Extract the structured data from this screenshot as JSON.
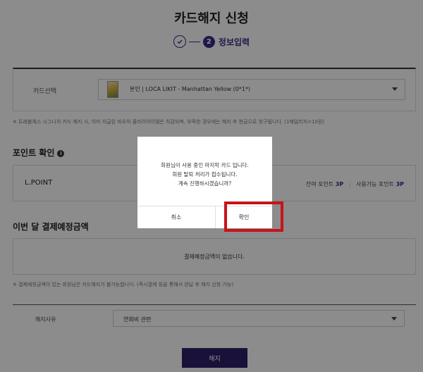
{
  "page": {
    "title": "카드해지 신청",
    "steps": {
      "current_number": "2",
      "current_label": "정보입력"
    }
  },
  "card_section": {
    "label": "카드선택",
    "selected_card": "본인 | LOCA LIKIT - Manhattan Yellow (0*1*)"
  },
  "note_top": "※ 트래블체스 시그니처 카드 해지 시, 이미 지급된 바우처 플라이아이템은 차감되며, 부족한 경우에는 해지 후 현금으로 청구됩니다. (1매일리지=10원)",
  "points": {
    "title": "포인트 확인",
    "info_icon": "i",
    "name": "L.POINT",
    "remaining_label": "잔여 포인트",
    "remaining_value": "3P",
    "usable_label": "사용가능 포인트",
    "usable_value": "3P"
  },
  "payment": {
    "title": "이번 달 결제예정금액",
    "message": "결제예정금액이 없습니다."
  },
  "note_bottom": "※ 결제예정금액이 있는 회원님은 카드해지가 불가능합니다. (즉시결제 등을 통해서 완납 후 해지 신청 가능)",
  "reason": {
    "label": "해지사유",
    "selected": "연회비 관련"
  },
  "submit_label": "해지",
  "modal": {
    "line1": "회원님이 사용 중인 마지막 카드 입니다.",
    "line2": "회원 탈퇴 처리가 접수됩니다.",
    "line3": "계속 진행하시겠습니까?",
    "cancel_label": "취소",
    "confirm_label": "확인"
  },
  "colors": {
    "brand": "#2e1f6b",
    "accent": "#3d2a88",
    "highlight": "#c8131a"
  }
}
